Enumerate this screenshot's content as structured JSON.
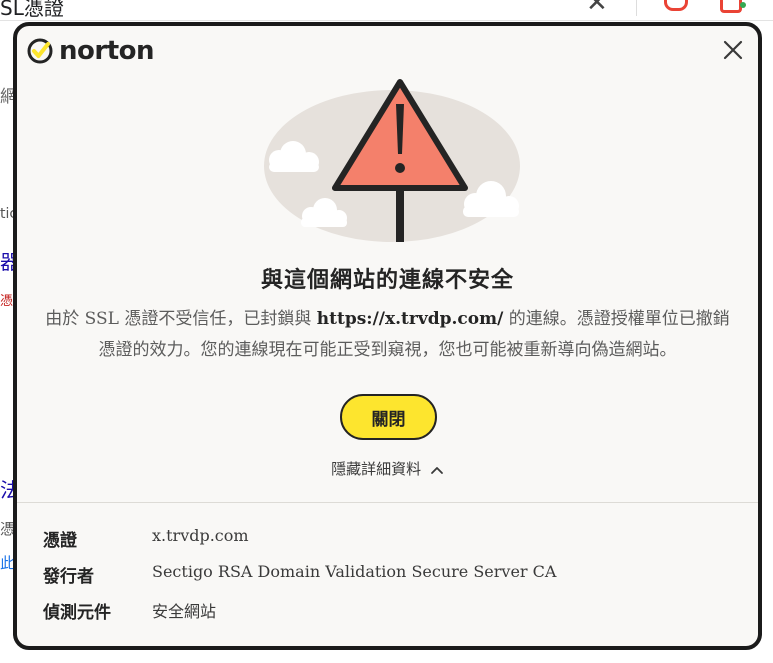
{
  "background": {
    "search_query": "SL憑證",
    "fragments": [
      "網",
      "tic",
      "器",
      "憑",
      "法",
      "憑",
      "此"
    ]
  },
  "dialog": {
    "brand": "norton",
    "title": "與這個網站的連線不安全",
    "description_pre": "由於 SSL 憑證不受信任，已封鎖與 ",
    "description_url": "https://x.trvdp.com/",
    "description_post": " 的連線。憑證授權單位已撤銷憑證的效力。您的連線現在可能正受到窺視，您也可能被重新導向偽造網站。",
    "close_button_label": "關閉",
    "toggle_details_label": "隱藏詳細資料",
    "details": [
      {
        "label": "憑證",
        "value": "x.trvdp.com"
      },
      {
        "label": "發行者",
        "value": "Sectigo RSA Domain Validation Secure Server CA"
      },
      {
        "label": "偵測元件",
        "value": "安全網站"
      }
    ],
    "colors": {
      "accent_yellow": "#fde52e",
      "warning_fill": "#f4806b",
      "outline": "#242424",
      "background": "#f9f8f6"
    },
    "icons": [
      "norton-logo-check-icon",
      "close-icon",
      "warning-triangle-icon",
      "chevron-up-icon"
    ]
  }
}
